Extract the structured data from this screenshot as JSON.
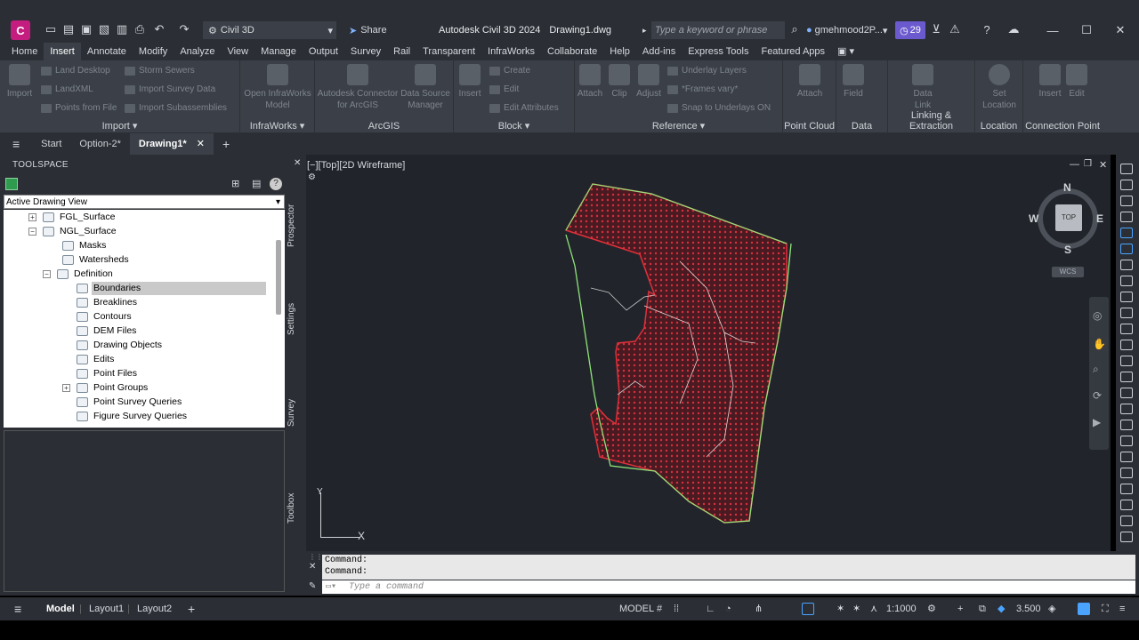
{
  "titlebar": {
    "app_logo": "C",
    "workspace": "Civil 3D",
    "share_label": "Share",
    "app_title": "Autodesk Civil 3D 2024",
    "doc_title": "Drawing1.dwg",
    "search_placeholder": "Type a keyword or phrase",
    "user_name": "gmehmood2P...",
    "badge_count": "29"
  },
  "menubar": {
    "items": [
      "Home",
      "Insert",
      "Annotate",
      "Modify",
      "Analyze",
      "View",
      "Manage",
      "Output",
      "Survey",
      "Rail",
      "Transparent",
      "InfraWorks",
      "Collaborate",
      "Help",
      "Add-ins",
      "Express Tools",
      "Featured Apps"
    ],
    "active": "Insert"
  },
  "ribbon": {
    "import": {
      "title": "Import",
      "big": "Import",
      "items": [
        "Land Desktop",
        "LandXML",
        "Points from File",
        "Storm Sewers",
        "Import Survey Data",
        "Import Subassemblies"
      ]
    },
    "infraworks": {
      "title": "InfraWorks",
      "big": "Open InfraWorks Model"
    },
    "arcgis": {
      "title": "ArcGIS",
      "big1": "Autodesk Connector for ArcGIS",
      "big2": "Data Source Manager"
    },
    "block": {
      "title": "Block",
      "big": "Insert",
      "items": [
        "Create",
        "Edit",
        "Edit Attributes"
      ]
    },
    "reference": {
      "title": "Reference",
      "big": [
        "Attach",
        "Clip",
        "Adjust"
      ],
      "items": [
        "Underlay Layers",
        "*Frames vary*",
        "Snap to Underlays ON"
      ]
    },
    "pointcloud": {
      "title": "Point Cloud",
      "big": "Attach"
    },
    "data": {
      "title": "Data",
      "big": "Field"
    },
    "linking": {
      "title": "Linking & Extraction",
      "big": "Data Link"
    },
    "location": {
      "title": "Location",
      "big": "Set Location"
    },
    "connection": {
      "title": "Connection Point",
      "big": [
        "Insert",
        "Edit"
      ]
    }
  },
  "doc_tabs": {
    "items": [
      "Start",
      "Option-2*",
      "Drawing1*"
    ],
    "active": "Drawing1*"
  },
  "toolspace": {
    "header": "TOOLSPACE",
    "view_select": "Active Drawing View",
    "tree": [
      {
        "label": "FGL_Surface",
        "toggle": "+"
      },
      {
        "label": "NGL_Surface",
        "toggle": "-"
      },
      {
        "label": "Masks"
      },
      {
        "label": "Watersheds"
      },
      {
        "label": "Definition",
        "toggle": "-"
      },
      {
        "label": "Boundaries",
        "selected": true
      },
      {
        "label": "Breaklines"
      },
      {
        "label": "Contours"
      },
      {
        "label": "DEM Files"
      },
      {
        "label": "Drawing Objects"
      },
      {
        "label": "Edits"
      },
      {
        "label": "Point Files"
      },
      {
        "label": "Point Groups",
        "toggle": "+"
      },
      {
        "label": "Point Survey Queries"
      },
      {
        "label": "Figure Survey Queries"
      }
    ],
    "vtabs": [
      "Prospector",
      "Settings",
      "Survey",
      "Toolbox"
    ]
  },
  "viewport": {
    "label": "[−][Top][2D Wireframe]",
    "compass": {
      "n": "N",
      "s": "S",
      "e": "E",
      "w": "W",
      "top": "TOP"
    },
    "wcs": "WCS",
    "axis_x": "X",
    "axis_y": "Y",
    "surface_color": "#e0303a",
    "boundary_color": "#8fe37a"
  },
  "command": {
    "history": [
      "Command:",
      "Command:"
    ],
    "placeholder": "Type a command"
  },
  "statusbar": {
    "layout_tabs": [
      "Model",
      "Layout1",
      "Layout2"
    ],
    "active_layout": "Model",
    "space": "MODEL",
    "scale": "1:1000",
    "value": "3.500"
  }
}
